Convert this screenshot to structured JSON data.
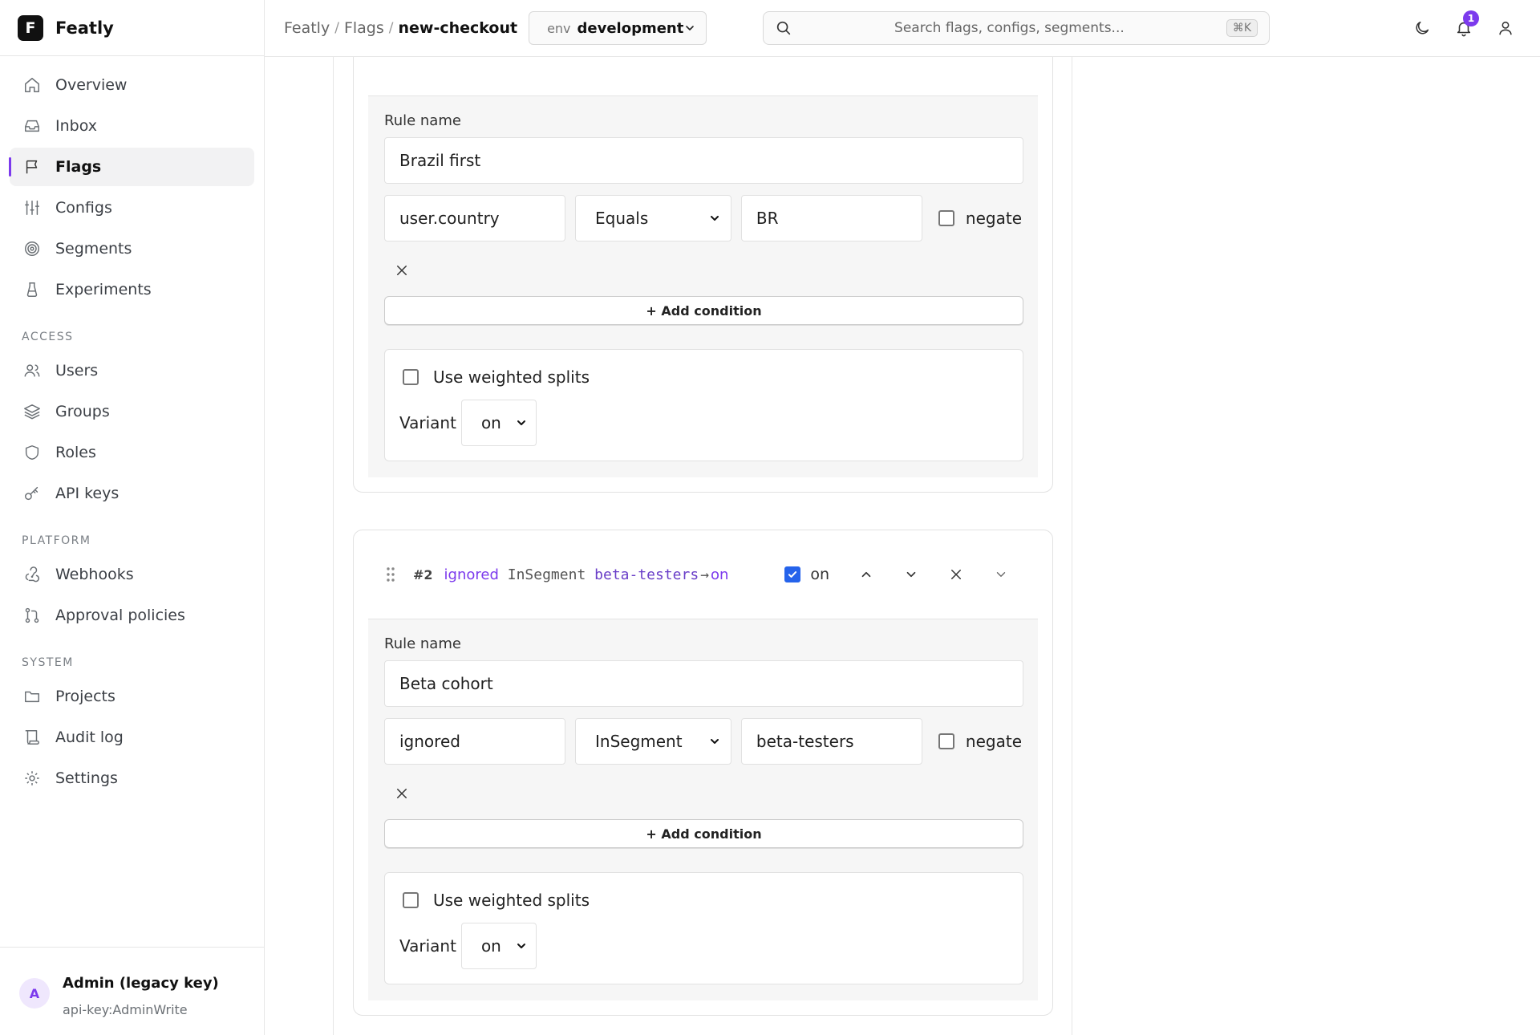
{
  "brand": {
    "logo_letter": "F",
    "name": "Featly"
  },
  "nav": {
    "main": [
      {
        "label": "Overview",
        "icon": "home-icon"
      },
      {
        "label": "Inbox",
        "icon": "inbox-icon"
      },
      {
        "label": "Flags",
        "icon": "flag-icon",
        "active": true
      },
      {
        "label": "Configs",
        "icon": "sliders-icon"
      },
      {
        "label": "Segments",
        "icon": "target-icon"
      },
      {
        "label": "Experiments",
        "icon": "flask-icon"
      }
    ],
    "access_title": "ACCESS",
    "access": [
      {
        "label": "Users",
        "icon": "users-icon"
      },
      {
        "label": "Groups",
        "icon": "layers-icon"
      },
      {
        "label": "Roles",
        "icon": "shield-icon"
      },
      {
        "label": "API keys",
        "icon": "key-icon"
      }
    ],
    "platform_title": "PLATFORM",
    "platform": [
      {
        "label": "Webhooks",
        "icon": "webhook-icon"
      },
      {
        "label": "Approval policies",
        "icon": "git-pull-icon"
      }
    ],
    "system_title": "SYSTEM",
    "system": [
      {
        "label": "Projects",
        "icon": "folder-icon"
      },
      {
        "label": "Audit log",
        "icon": "scroll-icon"
      },
      {
        "label": "Settings",
        "icon": "gear-icon"
      }
    ]
  },
  "user": {
    "initial": "A",
    "name": "Admin (legacy key)",
    "key": "api-key:AdminWrite"
  },
  "breadcrumb": [
    "Featly",
    "Flags",
    "new-checkout"
  ],
  "env": {
    "label": "env",
    "value": "development"
  },
  "search": {
    "placeholder": "Search flags, configs, segments...",
    "shortcut": "⌘K"
  },
  "notifications": {
    "count": "1"
  },
  "rules": [
    {
      "name_label": "Rule name",
      "name": "Brazil first",
      "condition": {
        "attribute": "user.country",
        "operator": "Equals",
        "value": "BR",
        "negate_label": "negate"
      },
      "add_condition_label": "+ Add condition",
      "splits_label": "Use weighted splits",
      "variant_label": "Variant",
      "variant": "on"
    },
    {
      "index": "#2",
      "summary": {
        "attribute": "ignored",
        "operator": "InSegment",
        "value": "beta-testers",
        "arrow": "→",
        "variant": "on"
      },
      "enabled": true,
      "enabled_label": "on",
      "name_label": "Rule name",
      "name": "Beta cohort",
      "condition": {
        "attribute": "ignored",
        "operator": "InSegment",
        "value": "beta-testers",
        "negate_label": "negate"
      },
      "add_condition_label": "+ Add condition",
      "splits_label": "Use weighted splits",
      "variant_label": "Variant",
      "variant": "on"
    }
  ],
  "colors": {
    "accent": "#7c3aed",
    "checkbox": "#2563eb"
  }
}
